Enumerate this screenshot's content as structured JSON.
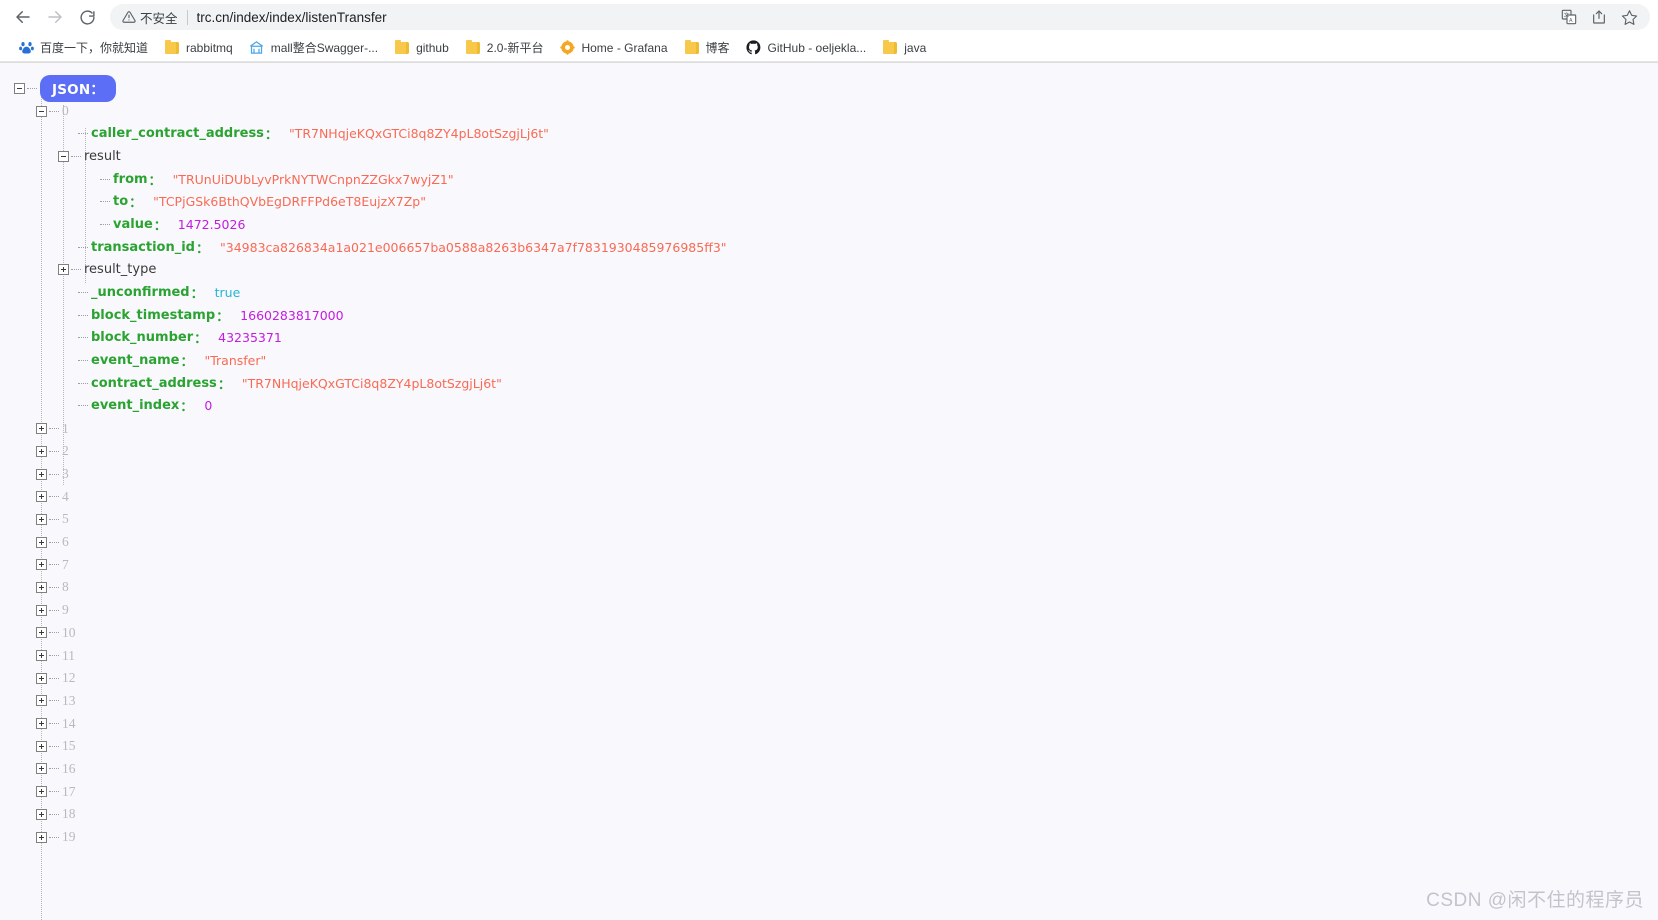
{
  "browser": {
    "nav": {
      "back_label": "Back",
      "forward_label": "Forward",
      "reload_label": "Reload"
    },
    "omnibox": {
      "security_warning": "不安全",
      "url": "trc.cn/index/index/listenTransfer",
      "actions": [
        "translate-icon",
        "share-icon",
        "bookmark-star-icon"
      ]
    },
    "bookmarks": [
      {
        "label": "百度一下，你就知道",
        "icon": "baidu-icon"
      },
      {
        "label": "rabbitmq",
        "icon": "folder-icon"
      },
      {
        "label": "mall整合Swagger-...",
        "icon": "swagger-icon"
      },
      {
        "label": "github",
        "icon": "folder-icon"
      },
      {
        "label": "2.0-新平台",
        "icon": "folder-icon"
      },
      {
        "label": "Home - Grafana",
        "icon": "grafana-icon"
      },
      {
        "label": "博客",
        "icon": "folder-icon"
      },
      {
        "label": "GitHub - oeljekla...",
        "icon": "github-icon"
      },
      {
        "label": "java",
        "icon": "folder-icon"
      }
    ]
  },
  "viewer": {
    "root_badge": "JSON：",
    "first_index": "0",
    "entries": [
      {
        "key": "caller_contract_address",
        "colon": "：",
        "value": "\"TR7NHqjeKQxGTCi8q8ZY4pL8otSzgjLj6t\"",
        "type": "string",
        "depth": 3,
        "node": "leaf"
      },
      {
        "key": "result",
        "colon": "",
        "value": "",
        "type": "object",
        "depth": 2,
        "node": "expanded"
      },
      {
        "key": "from",
        "colon": "：",
        "value": "\"TRUnUiDUbLyvPrkNYTWCnpnZZGkx7wyjZ1\"",
        "type": "string",
        "depth": 4,
        "node": "leaf"
      },
      {
        "key": "to",
        "colon": "：",
        "value": "\"TCPjGSk6BthQVbEgDRFFPd6eT8EujzX7Zp\"",
        "type": "string",
        "depth": 4,
        "node": "leaf"
      },
      {
        "key": "value",
        "colon": "：",
        "value": "1472.5026",
        "type": "number",
        "depth": 4,
        "node": "leaf-last"
      },
      {
        "key": "transaction_id",
        "colon": "：",
        "value": "\"34983ca826834a1a021e006657ba0588a8263b6347a7f7831930485976985ff3\"",
        "type": "string",
        "depth": 3,
        "node": "leaf"
      },
      {
        "key": "result_type",
        "colon": "",
        "value": "",
        "type": "object",
        "depth": 2,
        "node": "collapsed"
      },
      {
        "key": "_unconfirmed",
        "colon": "：",
        "value": "true",
        "type": "boolean",
        "depth": 3,
        "node": "leaf"
      },
      {
        "key": "block_timestamp",
        "colon": "：",
        "value": "1660283817000",
        "type": "number",
        "depth": 3,
        "node": "leaf"
      },
      {
        "key": "block_number",
        "colon": "：",
        "value": "43235371",
        "type": "number",
        "depth": 3,
        "node": "leaf"
      },
      {
        "key": "event_name",
        "colon": "：",
        "value": "\"Transfer\"",
        "type": "string",
        "depth": 3,
        "node": "leaf"
      },
      {
        "key": "contract_address",
        "colon": "：",
        "value": "\"TR7NHqjeKQxGTCi8q8ZY4pL8otSzgjLj6t\"",
        "type": "string",
        "depth": 3,
        "node": "leaf"
      },
      {
        "key": "event_index",
        "colon": "：",
        "value": "0",
        "type": "number",
        "depth": 3,
        "node": "leaf-last"
      }
    ],
    "collapsed_indices": [
      "1",
      "2",
      "3",
      "4",
      "5",
      "6",
      "7",
      "8",
      "9",
      "10",
      "11",
      "12",
      "13",
      "14",
      "15",
      "16",
      "17",
      "18",
      "19"
    ]
  },
  "watermark": "CSDN @闲不住的程序员",
  "colors": {
    "key": "#2aa331",
    "string": "#f96a54",
    "number": "#c41ce0",
    "boolean": "#22b6d6",
    "badge": "#5b6ef5",
    "background": "#f9f9fd",
    "index": "#b9b9be"
  }
}
